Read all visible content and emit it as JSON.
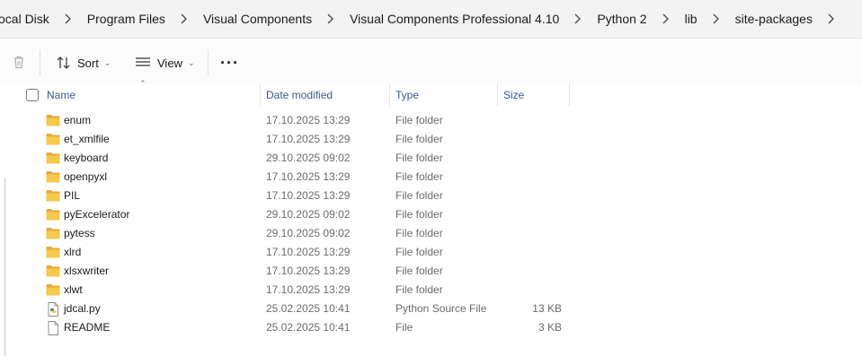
{
  "breadcrumb": {
    "items": [
      "ocal Disk",
      "Program Files",
      "Visual Components",
      "Visual Components Professional 4.10",
      "Python 2",
      "lib",
      "site-packages"
    ]
  },
  "toolbar": {
    "sort_label": "Sort",
    "view_label": "View",
    "more_label": "···"
  },
  "columns": {
    "name": "Name",
    "date": "Date modified",
    "type": "Type",
    "size": "Size"
  },
  "files": [
    {
      "name": "enum",
      "date": "17.10.2025 13:29",
      "type": "File folder",
      "size": "",
      "icon": "folder-icon"
    },
    {
      "name": "et_xmlfile",
      "date": "17.10.2025 13:29",
      "type": "File folder",
      "size": "",
      "icon": "folder-icon"
    },
    {
      "name": "keyboard",
      "date": "29.10.2025 09:02",
      "type": "File folder",
      "size": "",
      "icon": "folder-icon"
    },
    {
      "name": "openpyxl",
      "date": "17.10.2025 13:29",
      "type": "File folder",
      "size": "",
      "icon": "folder-icon"
    },
    {
      "name": "PIL",
      "date": "17.10.2025 13:29",
      "type": "File folder",
      "size": "",
      "icon": "folder-icon"
    },
    {
      "name": "pyExcelerator",
      "date": "29.10.2025 09:02",
      "type": "File folder",
      "size": "",
      "icon": "folder-icon"
    },
    {
      "name": "pytess",
      "date": "29.10.2025 09:02",
      "type": "File folder",
      "size": "",
      "icon": "folder-icon"
    },
    {
      "name": "xlrd",
      "date": "17.10.2025 13:29",
      "type": "File folder",
      "size": "",
      "icon": "folder-icon"
    },
    {
      "name": "xlsxwriter",
      "date": "17.10.2025 13:29",
      "type": "File folder",
      "size": "",
      "icon": "folder-icon"
    },
    {
      "name": "xlwt",
      "date": "17.10.2025 13:29",
      "type": "File folder",
      "size": "",
      "icon": "folder-icon"
    },
    {
      "name": "jdcal.py",
      "date": "25.02.2025 10:41",
      "type": "Python Source File",
      "size": "13 KB",
      "icon": "python-file-icon"
    },
    {
      "name": "README",
      "date": "25.02.2025 10:41",
      "type": "File",
      "size": "3 KB",
      "icon": "file-icon"
    }
  ],
  "colors": {
    "folder": "#f4c542",
    "header_text": "#3a5a8a",
    "muted_text": "#6b6b6b"
  }
}
